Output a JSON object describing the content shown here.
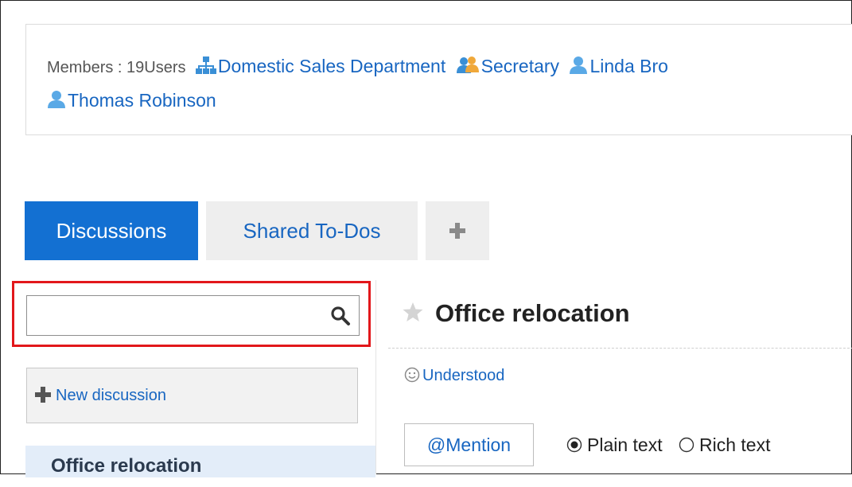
{
  "members": {
    "label": "Members : 19Users",
    "entries": [
      {
        "type": "department",
        "icon": "org-chart-icon",
        "name": "Domestic Sales Department"
      },
      {
        "type": "role",
        "icon": "group-icon",
        "name": "Secretary"
      },
      {
        "type": "user",
        "icon": "user-icon",
        "name": "Linda Bro"
      },
      {
        "type": "user",
        "icon": "user-icon",
        "name": "Thomas Robinson"
      }
    ]
  },
  "tabs": [
    {
      "label": "Discussions",
      "active": true
    },
    {
      "label": "Shared To-Dos",
      "active": false
    },
    {
      "label": "",
      "icon": "plus-icon"
    }
  ],
  "search": {
    "value": "",
    "placeholder": "",
    "icon": "search-icon",
    "highlight_color": "#e2171b"
  },
  "sidebar": {
    "new_discussion_label": "New discussion",
    "items": [
      {
        "label": "Office relocation",
        "selected": true
      }
    ]
  },
  "discussion": {
    "title": "Office relocation",
    "star_icon": "star-icon",
    "understood_label": "Understood",
    "mention_label": "Mention",
    "mention_symbol": "@",
    "format_options": [
      {
        "label": "Plain text",
        "selected": true
      },
      {
        "label": "Rich text",
        "selected": false
      }
    ]
  },
  "colors": {
    "accent": "#1370d2",
    "link": "#1866c1",
    "highlight": "#e2171b",
    "selected_row": "#e3edf9"
  }
}
